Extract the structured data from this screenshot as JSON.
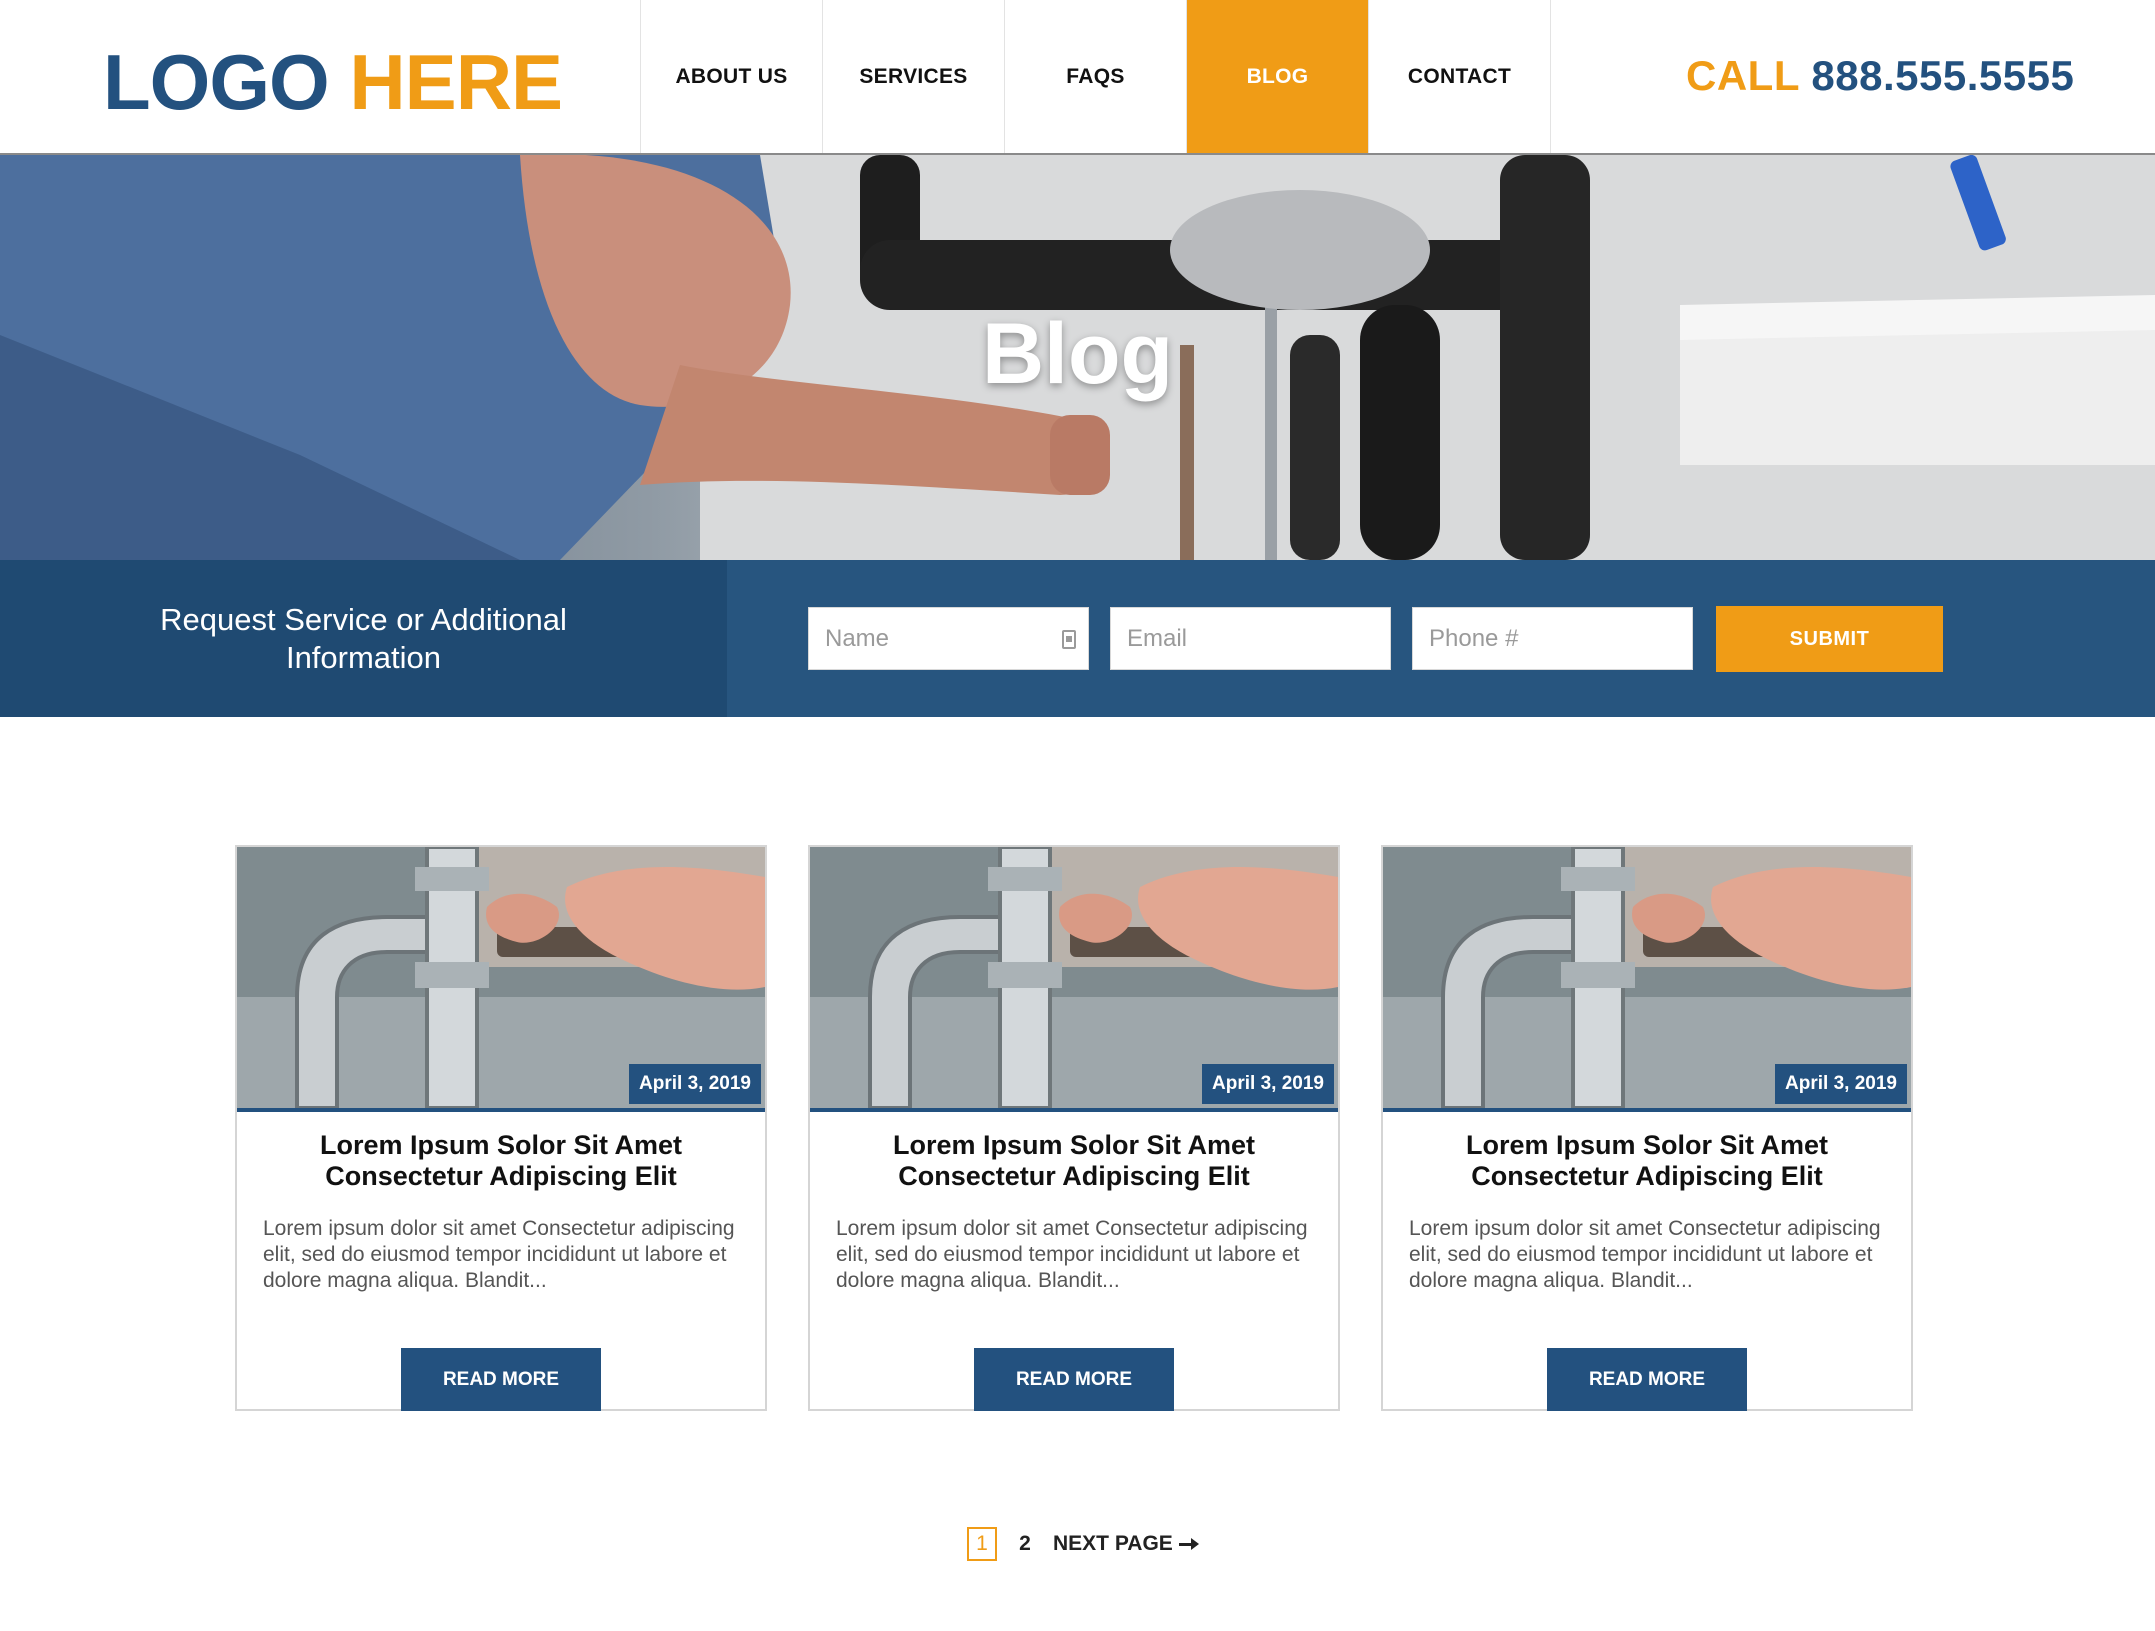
{
  "header": {
    "logo_part1": "LOGO",
    "logo_part2": "HERE",
    "nav": [
      "ABOUT US",
      "SERVICES",
      "FAQS",
      "BLOG",
      "CONTACT"
    ],
    "active_nav": "BLOG",
    "call_label": "CALL",
    "phone": "888.555.5555"
  },
  "hero": {
    "title": "Blog"
  },
  "request": {
    "text": "Request Service or Additional Information",
    "name_placeholder": "Name",
    "email_placeholder": "Email",
    "phone_placeholder": "Phone #",
    "submit_label": "SUBMIT"
  },
  "posts": [
    {
      "date": "April 3, 2019",
      "title": "Lorem Ipsum Solor Sit Amet Consectetur Adipiscing Elit",
      "excerpt": "Lorem ipsum dolor sit amet Consectetur adipiscing elit, sed do eiusmod tempor incididunt ut labore et dolore magna aliqua. Blandit...",
      "button": "READ MORE"
    },
    {
      "date": "April 3, 2019",
      "title": "Lorem Ipsum Solor Sit Amet Consectetur Adipiscing Elit",
      "excerpt": "Lorem ipsum dolor sit amet Consectetur adipiscing elit, sed do eiusmod tempor incididunt ut labore et dolore magna aliqua. Blandit...",
      "button": "READ MORE"
    },
    {
      "date": "April 3, 2019",
      "title": "Lorem Ipsum Solor Sit Amet Consectetur Adipiscing Elit",
      "excerpt": "Lorem ipsum dolor sit amet Consectetur adipiscing elit, sed do eiusmod tempor incididunt ut labore et dolore magna aliqua. Blandit...",
      "button": "READ MORE"
    }
  ],
  "pagination": {
    "current": "1",
    "next_num": "2",
    "next_label": "NEXT PAGE"
  },
  "colors": {
    "brand_blue": "#23517f",
    "brand_orange": "#f09c16"
  }
}
